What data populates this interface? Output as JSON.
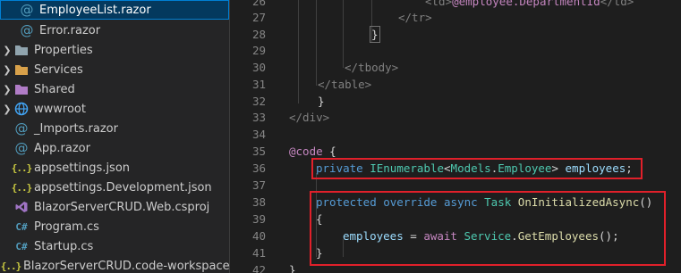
{
  "explorer": {
    "items": [
      {
        "label": "EmployeeList.razor",
        "icon": "razor-file-icon",
        "selected": true
      },
      {
        "label": "Error.razor",
        "icon": "razor-file-icon"
      },
      {
        "label": "Properties",
        "icon": "folder-icon"
      },
      {
        "label": "Services",
        "icon": "folder-icon"
      },
      {
        "label": "Shared",
        "icon": "folder-icon"
      },
      {
        "label": "wwwroot",
        "icon": "web-folder-icon"
      },
      {
        "label": "_Imports.razor",
        "icon": "razor-file-icon"
      },
      {
        "label": "App.razor",
        "icon": "razor-file-icon"
      },
      {
        "label": "appsettings.json",
        "icon": "json-file-icon"
      },
      {
        "label": "appsettings.Development.json",
        "icon": "json-file-icon"
      },
      {
        "label": "BlazorServerCRUD.Web.csproj",
        "icon": "csproj-file-icon"
      },
      {
        "label": "Program.cs",
        "icon": "csharp-file-icon"
      },
      {
        "label": "Startup.cs",
        "icon": "csharp-file-icon"
      },
      {
        "label": "BlazorServerCRUD.code-workspace",
        "icon": "workspace-file-icon"
      }
    ],
    "icon_glyphs": {
      "razor": "@",
      "json": "{..}",
      "cs": "C#",
      "workspace": "{..}"
    }
  },
  "editor": {
    "line_numbers": [
      "26",
      "27",
      "28",
      "29",
      "30",
      "31",
      "32",
      "33",
      "34",
      "35",
      "36",
      "37",
      "38",
      "39",
      "40",
      "41",
      "42"
    ],
    "lines": {
      "l26_open": "<td>",
      "l26_mid": "@employee.DepartmentId",
      "l26_close": "</td>",
      "l27": "</tr>",
      "l28": "}",
      "l30": "</tbody>",
      "l31": "</table>",
      "l32": "}",
      "l33": "</div>",
      "l35_kw": "@code",
      "l35_brace": " {",
      "l36_kw": "private",
      "l36_type": "IEnumerable",
      "l36_lt": "<",
      "l36_ns": "Models",
      "l36_dot": ".",
      "l36_cls": "Employee",
      "l36_gt": "> ",
      "l36_var": "employees",
      "l36_semi": ";",
      "l38_kw": "protected override async",
      "l38_type": "Task",
      "l38_fn": "OnInitializedAsync",
      "l38_paren": "()",
      "l39": "{",
      "l40_var": "employees",
      "l40_eq": " = ",
      "l40_kw": "await",
      "l40_svc": "Service",
      "l40_dot": ".",
      "l40_fn": "GetEmployees",
      "l40_end": "();",
      "l41": "}",
      "l42": "}"
    }
  },
  "colors": {
    "highlight_box": "#e0202a",
    "selection": "#04395e",
    "keyword": "#569cd6",
    "type": "#4ec9b0",
    "function": "#dcdcaa",
    "variable": "#9cdcfe"
  }
}
